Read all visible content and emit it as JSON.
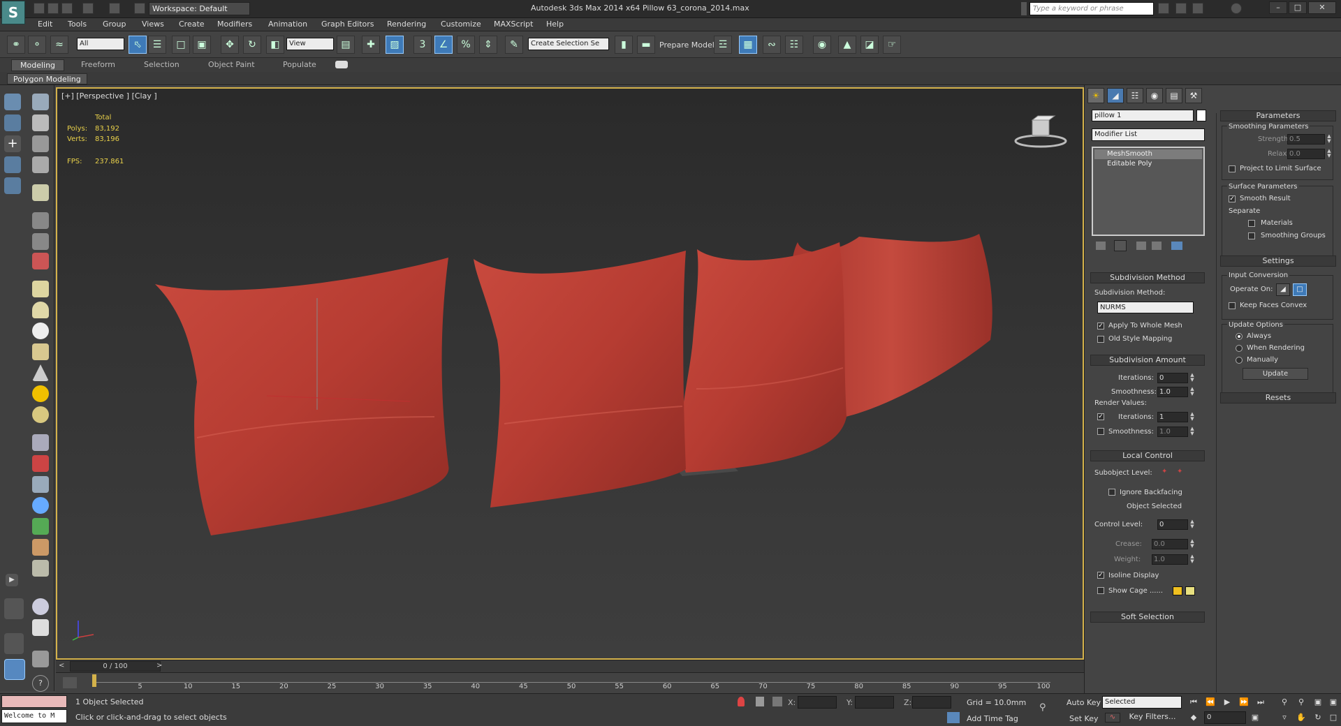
{
  "titlebar": {
    "logo_text": "S",
    "workspace": "Workspace: Default",
    "app_title": "Autodesk 3ds Max  2014 x64",
    "file_name": "Pillow 63_corona_2014.max",
    "search_placeholder": "Type a keyword or phrase"
  },
  "menu": [
    "Edit",
    "Tools",
    "Group",
    "Views",
    "Create",
    "Modifiers",
    "Animation",
    "Graph Editors",
    "Rendering",
    "Customize",
    "MAXScript",
    "Help"
  ],
  "toolbar": {
    "selection_filter": "All",
    "ref_coord": "View",
    "named_selection": "Create Selection Se",
    "prepare_model": "Prepare Model"
  },
  "ribbon": {
    "tabs": [
      "Modeling",
      "Freeform",
      "Selection",
      "Object Paint",
      "Populate"
    ],
    "active_tab": "Modeling",
    "sub_label": "Polygon Modeling"
  },
  "viewport": {
    "label": "[+] [Perspective ] [Clay ]",
    "stats_total": "Total",
    "polys_label": "Polys:",
    "polys_value": "83,192",
    "verts_label": "Verts:",
    "verts_value": "83,196",
    "fps_label": "FPS:",
    "fps_value": "237.861",
    "pillow_color": "#c0443a"
  },
  "timeline": {
    "slider": "0 / 100",
    "ticks": [
      "5",
      "10",
      "15",
      "20",
      "25",
      "30",
      "35",
      "40",
      "45",
      "50",
      "55",
      "60",
      "65",
      "70",
      "75",
      "80",
      "85",
      "90",
      "95",
      "100"
    ]
  },
  "status": {
    "maxscript_listener": "Welcome to M",
    "prompt": "1 Object Selected",
    "help": "Click or click-and-drag to select objects",
    "x_label": "X:",
    "y_label": "Y:",
    "z_label": "Z:",
    "grid": "Grid = 10.0mm",
    "add_time_tag": "Add Time Tag",
    "auto_key": "Auto Key",
    "set_key": "Set Key",
    "selected_dd": "Selected",
    "key_filters": "Key Filters...",
    "frame": "0"
  },
  "command_panel": {
    "object_name": "pillow 1",
    "modifier_list": "Modifier List",
    "stack": [
      "MeshSmooth",
      "Editable Poly"
    ],
    "subdivision_method": {
      "title": "Subdivision Method",
      "label": "Subdivision Method:",
      "value": "NURMS",
      "apply_whole_mesh": "Apply To Whole Mesh",
      "old_style_mapping": "Old Style Mapping"
    },
    "subdivision_amount": {
      "title": "Subdivision Amount",
      "iterations_label": "Iterations:",
      "iterations_value": "0",
      "smoothness_label": "Smoothness:",
      "smoothness_value": "1.0",
      "render_values": "Render Values:",
      "r_iterations_label": "Iterations:",
      "r_iterations_value": "1",
      "r_smoothness_label": "Smoothness:",
      "r_smoothness_value": "1.0"
    },
    "local_control": {
      "title": "Local Control",
      "subobject_level": "Subobject Level:",
      "ignore_backfacing": "Ignore Backfacing",
      "object_selected": "Object Selected",
      "control_level_label": "Control Level:",
      "control_level_value": "0",
      "crease_label": "Crease:",
      "crease_value": "0.0",
      "weight_label": "Weight:",
      "weight_value": "1.0",
      "isoline_display": "Isoline Display",
      "show_cage": "Show Cage ......",
      "cage_color1": "#f0c020",
      "cage_color2": "#e8e080"
    },
    "soft_selection": "Soft Selection",
    "parameters": {
      "title": "Parameters",
      "smoothing_params": "Smoothing Parameters",
      "strength_label": "Strength:",
      "strength_value": "0.5",
      "relax_label": "Relax:",
      "relax_value": "0.0",
      "project_limit": "Project to Limit Surface",
      "surface_params": "Surface Parameters",
      "smooth_result": "Smooth Result",
      "separate": "Separate",
      "materials": "Materials",
      "smoothing_groups": "Smoothing Groups"
    },
    "settings": {
      "title": "Settings",
      "input_conversion": "Input Conversion",
      "operate_on": "Operate On:",
      "keep_faces_convex": "Keep Faces Convex",
      "update_options": "Update Options",
      "always": "Always",
      "when_rendering": "When Rendering",
      "manually": "Manually",
      "update_btn": "Update"
    },
    "resets": "Resets"
  }
}
